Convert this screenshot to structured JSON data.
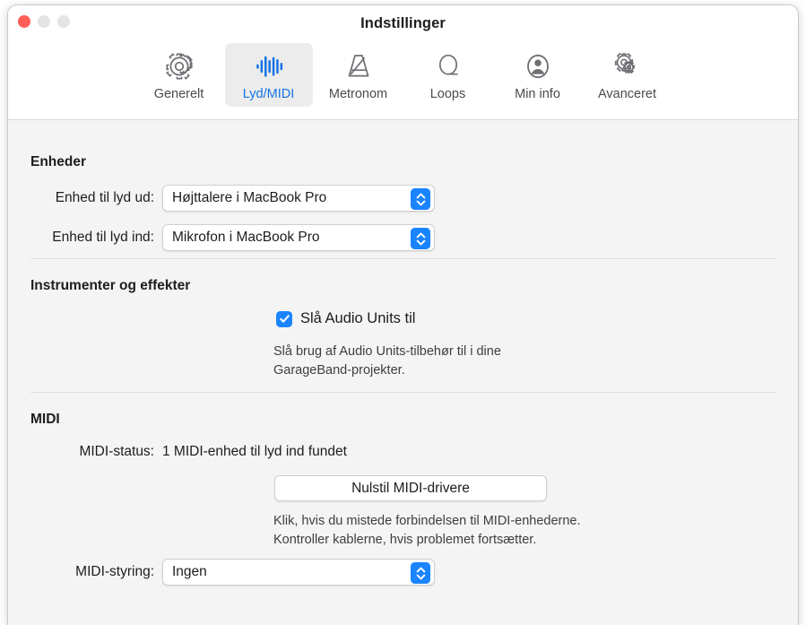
{
  "window": {
    "title": "Indstillinger",
    "traffic_lights": [
      {
        "name": "close",
        "color": "#ff5f57"
      },
      {
        "name": "minimize",
        "color": "#e4e4e4"
      },
      {
        "name": "zoom",
        "color": "#e4e4e4"
      }
    ]
  },
  "toolbar": {
    "tabs": [
      {
        "label": "Generelt",
        "icon": "gear-icon",
        "selected": false
      },
      {
        "label": "Lyd/MIDI",
        "icon": "waveform-icon",
        "selected": true
      },
      {
        "label": "Metronom",
        "icon": "metronome-icon",
        "selected": false
      },
      {
        "label": "Loops",
        "icon": "loop-icon",
        "selected": false
      },
      {
        "label": "Min info",
        "icon": "person-circle-icon",
        "selected": false
      },
      {
        "label": "Avanceret",
        "icon": "two-gears-icon",
        "selected": false
      }
    ],
    "accent_color": "#1473e6",
    "selected_background": "#ececec"
  },
  "devices": {
    "heading": "Enheder",
    "output": {
      "label": "Enhed til lyd ud:",
      "value": "Højttalere i MacBook Pro"
    },
    "input": {
      "label": "Enhed til lyd ind:",
      "value": "Mikrofon i MacBook Pro"
    }
  },
  "instruments": {
    "heading": "Instrumenter og effekter",
    "audio_units": {
      "label": "Slå Audio Units til",
      "checked": true,
      "help": "Slå brug af Audio Units-tilbehør til i dine\nGarageBand-projekter."
    }
  },
  "midi": {
    "heading": "MIDI",
    "status": {
      "label": "MIDI-status:",
      "value": "1 MIDI-enhed til lyd ind fundet"
    },
    "reset_button": "Nulstil MIDI-drivere",
    "help": "Klik, hvis du mistede forbindelsen til MIDI-enhederne.\nKontroller kablerne, hvis problemet fortsætter.",
    "control": {
      "label": "MIDI-styring:",
      "value": "Ingen"
    }
  },
  "colors": {
    "accent_blue": "#1a84ff",
    "toolbar_blue": "#1473e6",
    "body_background": "#f4f4f4",
    "chrome_background": "#ffffff"
  }
}
